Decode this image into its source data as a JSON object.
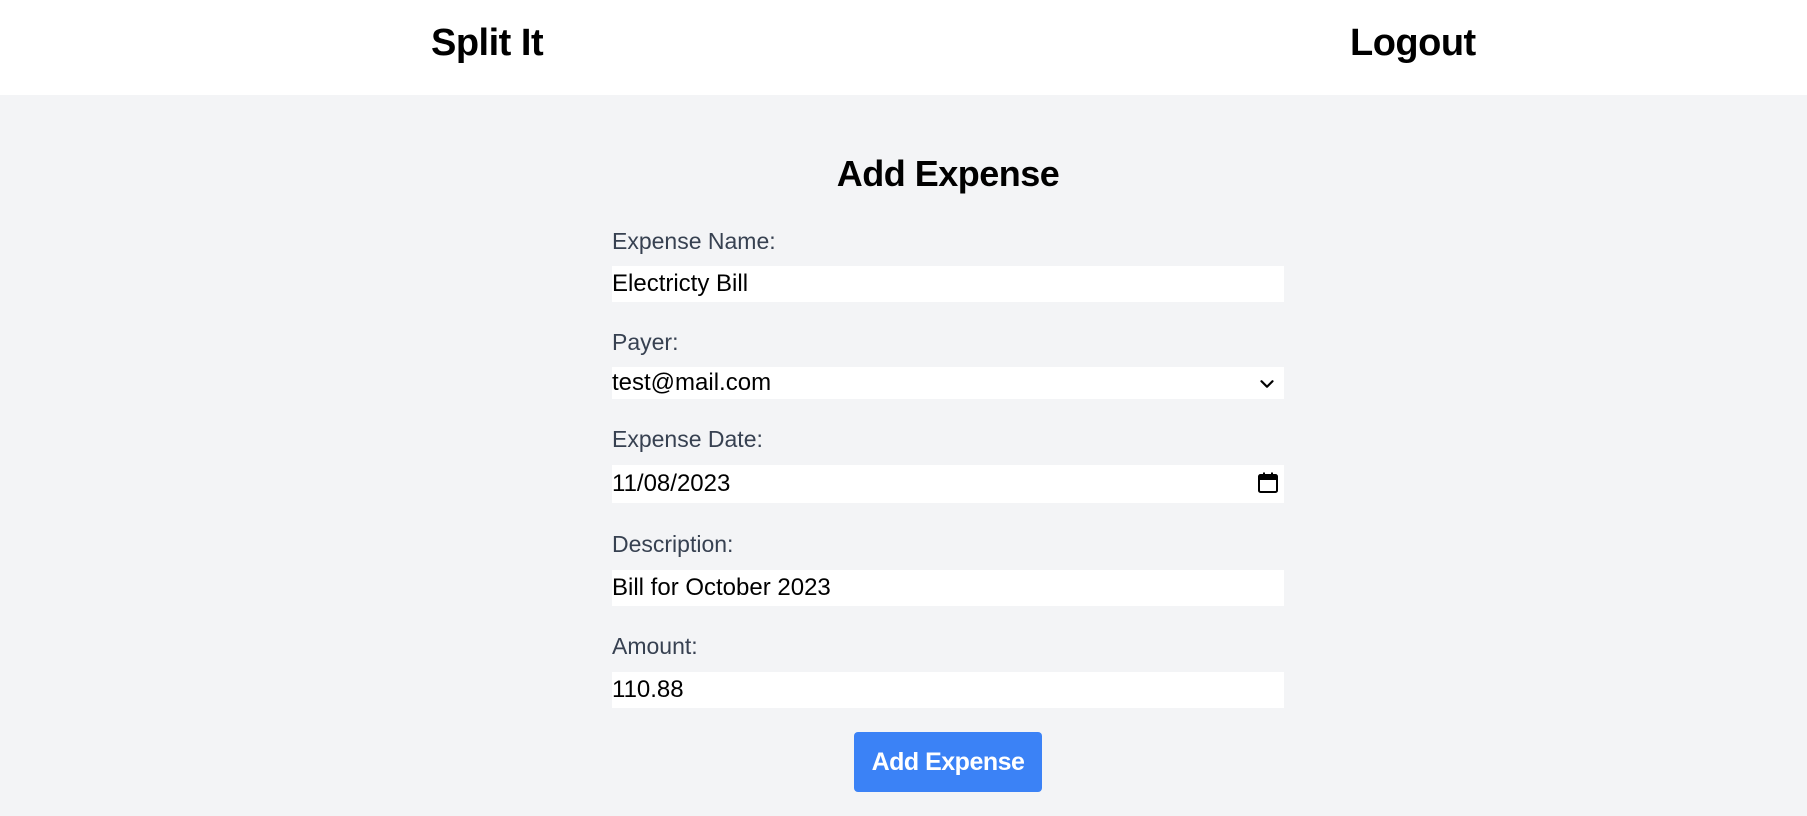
{
  "header": {
    "brand": "Split It",
    "logout_label": "Logout"
  },
  "form": {
    "title": "Add Expense",
    "fields": {
      "expense_name": {
        "label": "Expense Name:",
        "value": "Electricty Bill"
      },
      "payer": {
        "label": "Payer:",
        "value": "test@mail.com"
      },
      "expense_date": {
        "label": "Expense Date:",
        "value": "11/08/2023"
      },
      "description": {
        "label": "Description:",
        "value": "Bill for October 2023"
      },
      "amount": {
        "label": "Amount:",
        "value": "110.88"
      }
    },
    "submit_label": "Add Expense"
  },
  "colors": {
    "page_bg": "#f3f4f6",
    "header_bg": "#ffffff",
    "button_bg": "#3b82f6",
    "label_text": "#374151"
  },
  "icons": {
    "payer_dropdown": "chevron-down-icon",
    "date_picker": "calendar-icon"
  }
}
